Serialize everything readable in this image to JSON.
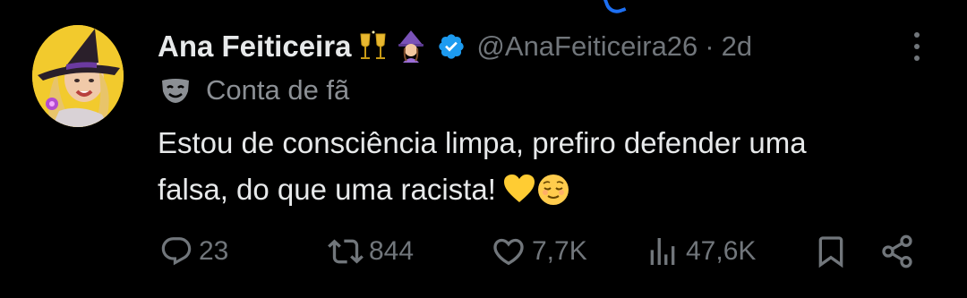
{
  "tweet": {
    "display_name": "Ana Feiticeira",
    "name_emojis": [
      "clinking-glasses",
      "mage-woman"
    ],
    "verified": true,
    "handle": "@AnaFeiticeira26",
    "separator": "·",
    "time": "2d",
    "fan_label": "Conta de fã",
    "text_line1": "Estou de consciência limpa, prefiro defender uma",
    "text_line2": "falsa, do que uma racista!",
    "text_emojis": [
      "yellow-heart",
      "relieved-face"
    ]
  },
  "actions": {
    "replies": "23",
    "reposts": "844",
    "likes": "7,7K",
    "views": "47,6K"
  },
  "colors": {
    "background": "#000000",
    "primary_text": "#e7e9ea",
    "secondary_text": "#71767b",
    "verified_blue": "#1d9bf0",
    "avatar_bg": "#f2ca2d"
  }
}
